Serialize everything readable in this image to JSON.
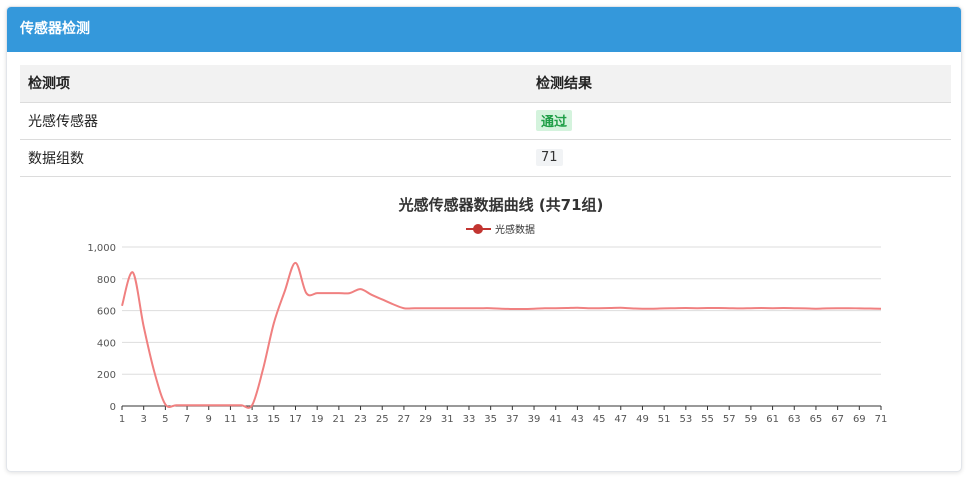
{
  "header": {
    "title": "传感器检测"
  },
  "table": {
    "columns": [
      "检测项",
      "检测结果"
    ],
    "rows": [
      {
        "item": "光感传感器",
        "result": "通过",
        "result_color": "#1e9e46"
      },
      {
        "item": "数据组数",
        "result": "71"
      }
    ]
  },
  "colors": {
    "header_bg": "#3498db",
    "series_line": "#f08080",
    "legend_marker": "#c23531"
  },
  "chart_data": {
    "type": "line",
    "title": "光感传感器数据曲线 (共71组)",
    "legend": [
      "光感数据"
    ],
    "legend_position": "top-center",
    "xlabel": "",
    "ylabel": "",
    "ylim": [
      0,
      1000
    ],
    "yticks": [
      "0",
      "200",
      "400",
      "600",
      "800",
      "1,000"
    ],
    "x_tick_labels": [
      "1",
      "3",
      "5",
      "7",
      "9",
      "11",
      "13",
      "15",
      "17",
      "19",
      "21",
      "23",
      "25",
      "27",
      "29",
      "31",
      "33",
      "35",
      "37",
      "39",
      "41",
      "43",
      "45",
      "47",
      "49",
      "51",
      "53",
      "55",
      "57",
      "59",
      "61",
      "63",
      "65",
      "67",
      "69",
      "71"
    ],
    "grid": true,
    "series": [
      {
        "name": "光感数据",
        "x": [
          1,
          2,
          3,
          4,
          5,
          6,
          7,
          8,
          9,
          10,
          11,
          12,
          13,
          14,
          15,
          16,
          17,
          18,
          19,
          20,
          21,
          22,
          23,
          24,
          25,
          26,
          27,
          28,
          29,
          30,
          31,
          32,
          33,
          34,
          35,
          36,
          37,
          38,
          39,
          40,
          41,
          42,
          43,
          44,
          45,
          46,
          47,
          48,
          49,
          50,
          51,
          52,
          53,
          54,
          55,
          56,
          57,
          58,
          59,
          60,
          61,
          62,
          63,
          64,
          65,
          66,
          67,
          68,
          69,
          70,
          71
        ],
        "values": [
          630,
          840,
          500,
          210,
          10,
          5,
          5,
          5,
          5,
          5,
          5,
          5,
          5,
          230,
          520,
          720,
          900,
          710,
          710,
          710,
          710,
          710,
          735,
          700,
          670,
          640,
          615,
          615,
          615,
          615,
          615,
          615,
          615,
          615,
          615,
          612,
          610,
          610,
          612,
          615,
          615,
          616,
          618,
          615,
          615,
          616,
          618,
          614,
          612,
          612,
          614,
          615,
          616,
          615,
          616,
          616,
          615,
          614,
          615,
          616,
          615,
          616,
          615,
          614,
          612,
          614,
          615,
          615,
          614,
          613,
          612
        ]
      }
    ]
  }
}
